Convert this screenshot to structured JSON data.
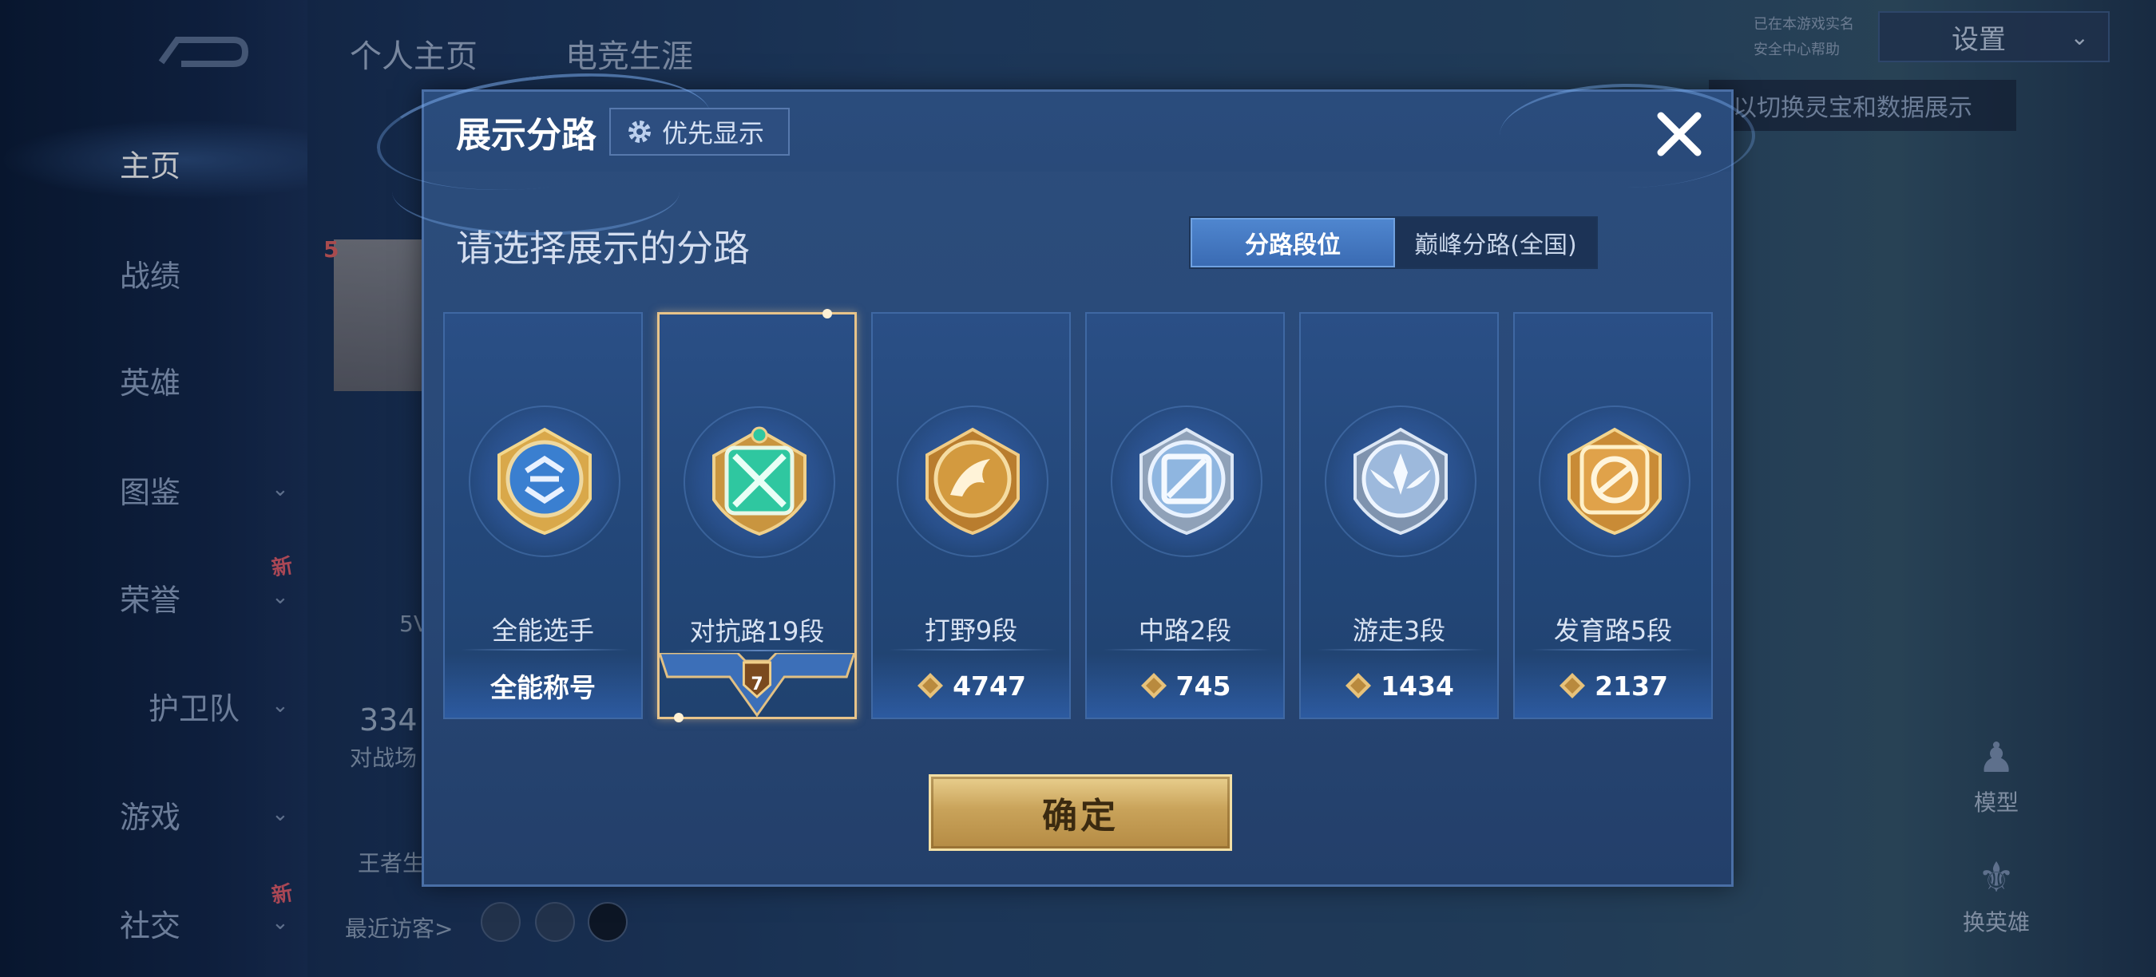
{
  "background": {
    "sidebar": {
      "items": [
        {
          "label": "主页",
          "active": true
        },
        {
          "label": "战绩"
        },
        {
          "label": "英雄"
        },
        {
          "label": "图鉴",
          "chevron": true
        },
        {
          "label": "荣誉",
          "chevron": true,
          "new": "新"
        },
        {
          "label": "护卫队",
          "chevron": true
        },
        {
          "label": "游戏",
          "chevron": true
        },
        {
          "label": "社交",
          "chevron": true,
          "new": "新"
        }
      ]
    },
    "top_tabs": [
      "个人主页",
      "电竞生涯"
    ],
    "settings_label": "设置",
    "hint_text": "以切换灵宝和数据展示",
    "level_badge": "5",
    "stat_value": "334",
    "stat_label": "对战场",
    "small_5": "5V",
    "wangzhe_label": "王者生",
    "recent_visitors": "最近访客>",
    "realname_lines": [
      "已在本游戏实名",
      "安全中心帮助"
    ],
    "model_label": "模型",
    "swap_hero_label": "换英雄"
  },
  "modal": {
    "title": "展示分路",
    "priority_label": "优先显示",
    "subtitle": "请选择展示的分路",
    "toggle": [
      {
        "label": "分路段位",
        "active": true
      },
      {
        "label": "巅峰分路(全国)",
        "active": false
      }
    ],
    "cards": [
      {
        "name": "全能选手",
        "bottom": "全能称号",
        "score_icon": false,
        "badge_color": "#3a7fd0",
        "selected": false
      },
      {
        "name": "对抗路19段",
        "ribbon_number": "7",
        "badge_color": "#2fc7a0",
        "selected": true
      },
      {
        "name": "打野9段",
        "bottom": "4747",
        "score_icon": true,
        "badge_color": "#d39a3f",
        "selected": false
      },
      {
        "name": "中路2段",
        "bottom": "745",
        "score_icon": true,
        "badge_color": "#8fb6e0",
        "selected": false
      },
      {
        "name": "游走3段",
        "bottom": "1434",
        "score_icon": true,
        "badge_color": "#9db9dc",
        "selected": false
      },
      {
        "name": "发育路5段",
        "bottom": "2137",
        "score_icon": true,
        "badge_color": "#e0a24a",
        "selected": false
      }
    ],
    "confirm_label": "确定"
  }
}
